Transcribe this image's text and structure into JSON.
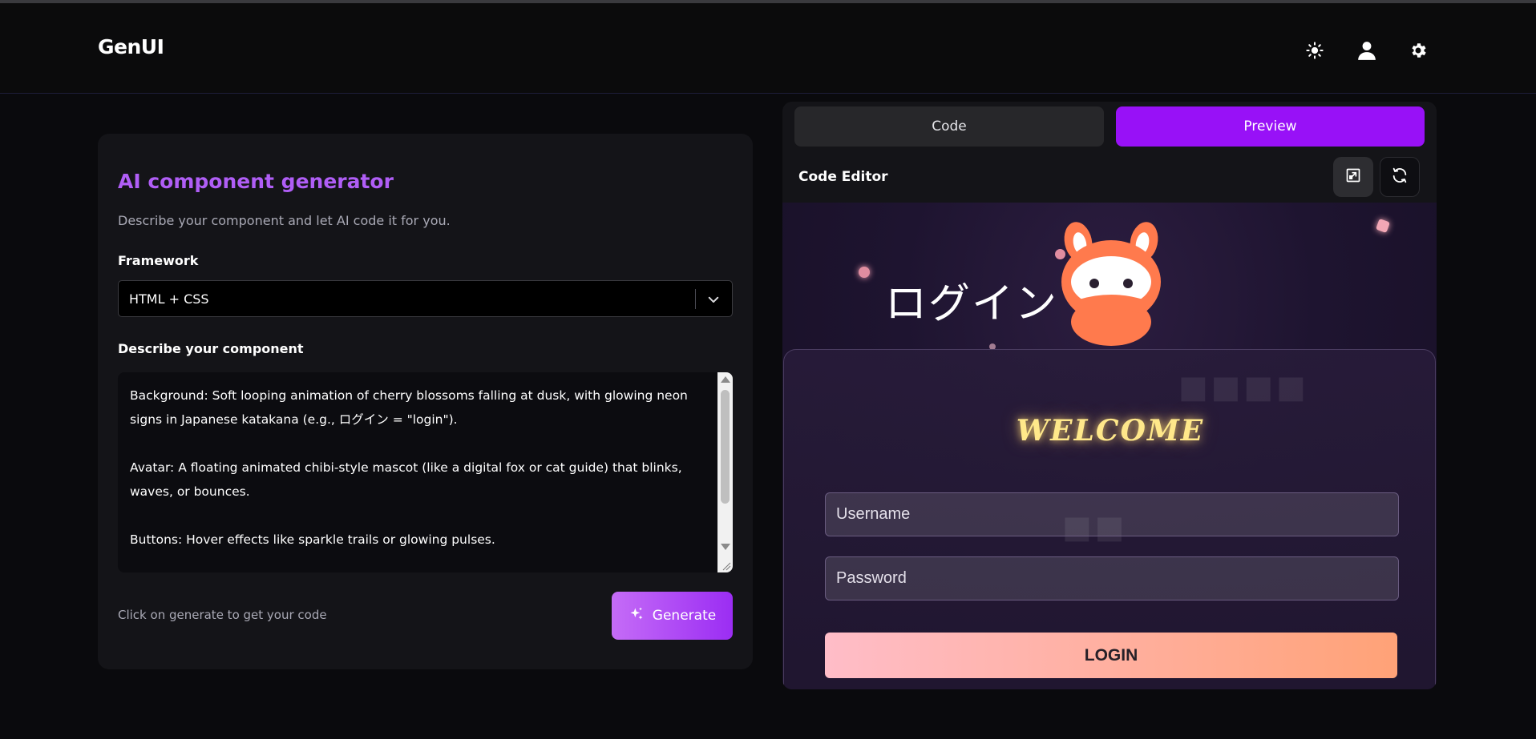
{
  "header": {
    "logo": "GenUI",
    "icons": [
      "sun-icon",
      "user-icon",
      "gear-icon"
    ]
  },
  "generator": {
    "title": "AI component generator",
    "subtitle": "Describe your component and let AI code it for you.",
    "framework_label": "Framework",
    "framework_value": "HTML + CSS",
    "describe_label": "Describe your component",
    "description": "Background: Soft looping animation of cherry blossoms falling at dusk, with glowing neon signs in Japanese katakana (e.g., ログイン = \"login\").\n\nAvatar: A floating animated chibi-style mascot (like a digital fox or cat guide) that blinks, waves, or bounces.\n\nButtons: Hover effects like sparkle trails or glowing pulses.",
    "hint": "Click on generate to get your code",
    "generate_label": "Generate"
  },
  "panel": {
    "tabs": [
      {
        "label": "Code",
        "active": false
      },
      {
        "label": "Preview",
        "active": true
      }
    ],
    "editor_label": "Code Editor",
    "accent_color": "#9811f7"
  },
  "preview": {
    "katakana": "ログイン",
    "welcome": "WELCOME",
    "username_placeholder": "Username",
    "password_placeholder": "Password",
    "login_label": "LOGIN"
  }
}
